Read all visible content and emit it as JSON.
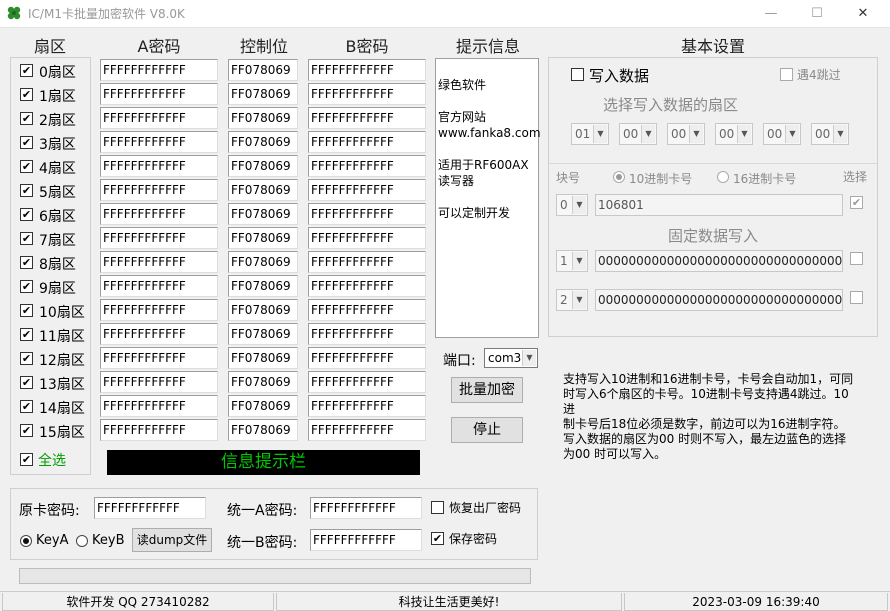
{
  "window": {
    "title": "IC/M1卡批量加密软件 V8.0K",
    "minimize": "—",
    "maximize": "☐",
    "close": "✕"
  },
  "headers": {
    "sector": "扇区",
    "key_a": "A密码",
    "control": "控制位",
    "key_b": "B密码",
    "info": "提示信息",
    "settings": "基本设置"
  },
  "sectors": [
    {
      "label": "0扇区",
      "checked": true,
      "key_a": "FFFFFFFFFFFF",
      "control": "FF078069",
      "key_b": "FFFFFFFFFFFF"
    },
    {
      "label": "1扇区",
      "checked": true,
      "key_a": "FFFFFFFFFFFF",
      "control": "FF078069",
      "key_b": "FFFFFFFFFFFF"
    },
    {
      "label": "2扇区",
      "checked": true,
      "key_a": "FFFFFFFFFFFF",
      "control": "FF078069",
      "key_b": "FFFFFFFFFFFF"
    },
    {
      "label": "3扇区",
      "checked": true,
      "key_a": "FFFFFFFFFFFF",
      "control": "FF078069",
      "key_b": "FFFFFFFFFFFF"
    },
    {
      "label": "4扇区",
      "checked": true,
      "key_a": "FFFFFFFFFFFF",
      "control": "FF078069",
      "key_b": "FFFFFFFFFFFF"
    },
    {
      "label": "5扇区",
      "checked": true,
      "key_a": "FFFFFFFFFFFF",
      "control": "FF078069",
      "key_b": "FFFFFFFFFFFF"
    },
    {
      "label": "6扇区",
      "checked": true,
      "key_a": "FFFFFFFFFFFF",
      "control": "FF078069",
      "key_b": "FFFFFFFFFFFF"
    },
    {
      "label": "7扇区",
      "checked": true,
      "key_a": "FFFFFFFFFFFF",
      "control": "FF078069",
      "key_b": "FFFFFFFFFFFF"
    },
    {
      "label": "8扇区",
      "checked": true,
      "key_a": "FFFFFFFFFFFF",
      "control": "FF078069",
      "key_b": "FFFFFFFFFFFF"
    },
    {
      "label": "9扇区",
      "checked": true,
      "key_a": "FFFFFFFFFFFF",
      "control": "FF078069",
      "key_b": "FFFFFFFFFFFF"
    },
    {
      "label": "10扇区",
      "checked": true,
      "key_a": "FFFFFFFFFFFF",
      "control": "FF078069",
      "key_b": "FFFFFFFFFFFF"
    },
    {
      "label": "11扇区",
      "checked": true,
      "key_a": "FFFFFFFFFFFF",
      "control": "FF078069",
      "key_b": "FFFFFFFFFFFF"
    },
    {
      "label": "12扇区",
      "checked": true,
      "key_a": "FFFFFFFFFFFF",
      "control": "FF078069",
      "key_b": "FFFFFFFFFFFF"
    },
    {
      "label": "13扇区",
      "checked": true,
      "key_a": "FFFFFFFFFFFF",
      "control": "FF078069",
      "key_b": "FFFFFFFFFFFF"
    },
    {
      "label": "14扇区",
      "checked": true,
      "key_a": "FFFFFFFFFFFF",
      "control": "FF078069",
      "key_b": "FFFFFFFFFFFF"
    },
    {
      "label": "15扇区",
      "checked": true,
      "key_a": "FFFFFFFFFFFF",
      "control": "FF078069",
      "key_b": "FFFFFFFFFFFF"
    }
  ],
  "select_all": {
    "label": "全选",
    "checked": true,
    "color": "#00a000"
  },
  "info_panel": {
    "lines": [
      "绿色软件",
      "官方网站",
      "www.fanka8.com",
      "适用于RF600AX",
      "读写器",
      "可以定制开发"
    ]
  },
  "status_banner": {
    "text": "信息提示栏",
    "bg": "#000000",
    "fg": "#00c800"
  },
  "port": {
    "label": "端口:",
    "value": "com3"
  },
  "buttons": {
    "batch_encrypt": "批量加密",
    "stop": "停止",
    "read_dump": "读dump文件"
  },
  "settings": {
    "write_data_label": "写入数据",
    "skip4_label": "遇4跳过",
    "select_sector_title": "选择写入数据的扇区",
    "sector_selects": [
      "01",
      "00",
      "00",
      "00",
      "00",
      "00"
    ],
    "block_label": "块号",
    "dec_label": "10进制卡号",
    "hex_label": "16进制卡号",
    "select_label": "选择",
    "block0": "0",
    "card_number": "106801",
    "fixed_title": "固定数据写入",
    "block1": "1",
    "fixed1": "00000000000000000000000000000000",
    "block2": "2",
    "fixed2": "00000000000000000000000000000000"
  },
  "help_text": [
    "支持写入10进制和16进制卡号，卡号会自动加1，可同",
    "时写入6个扇区的卡号。10进制卡号支持遇4跳过。10",
    "进",
    "制卡号后18位必须是数字，前边可以为16进制字符。",
    "写入数据的扇区为00 时则不写入，最左边蓝色的选择",
    "为00 时可以写入。"
  ],
  "bottom": {
    "orig_key_label": "原卡密码:",
    "orig_key_value": "FFFFFFFFFFFF",
    "unify_a_label": "统一A密码:",
    "unify_a_value": "FFFFFFFFFFFF",
    "unify_b_label": "统一B密码:",
    "unify_b_value": "FFFFFFFFFFFF",
    "restore_label": "恢复出厂密码",
    "save_label": "保存密码",
    "keya_label": "KeyA",
    "keyb_label": "KeyB"
  },
  "statusbar": {
    "dev": "软件开发 QQ 273410282",
    "slogan": "科技让生活更美好!",
    "datetime": "2023-03-09 16:39:40"
  }
}
